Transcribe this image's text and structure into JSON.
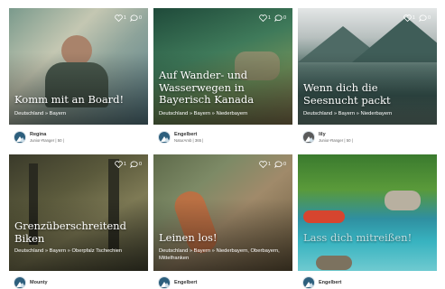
{
  "cards": [
    {
      "title": "Komm mit an Board!",
      "tags": "Deutschland » Bayern",
      "likes": "1",
      "comments": "0",
      "author": {
        "name": "Regina",
        "role": "Junior-Ranger | 50 |"
      }
    },
    {
      "title": "Auf Wander- und Wasserwegen in Bayerisch Kanada",
      "tags": "Deutschland » Bayern » Niederbayern",
      "likes": "1",
      "comments": "0",
      "author": {
        "name": "Engelbert",
        "role": "NaturAmb | 365 |"
      }
    },
    {
      "title": "Wenn dich die Seesnucht packt",
      "tags": "Deutschland » Bayern » Niederbayern",
      "likes": "1",
      "comments": "0",
      "author": {
        "name": "lily",
        "role": "Junior-Ranger | 50 |"
      }
    },
    {
      "title": "Grenzüberschreitend Biken",
      "tags": "Deutschland » Bayern » Oberpfalz Tschechien",
      "likes": "1",
      "comments": "0",
      "author": {
        "name": "Mounty",
        "role": ""
      }
    },
    {
      "title": "Leinen los!",
      "tags": "Deutschland » Bayern » Niederbayern, Oberbayern, Mittelfranken",
      "likes": "1",
      "comments": "0",
      "author": {
        "name": "Engelbert",
        "role": ""
      }
    },
    {
      "title": "Lass dich mitreißen!",
      "tags": "",
      "likes": "",
      "comments": "",
      "author": {
        "name": "Engelbert",
        "role": ""
      }
    }
  ],
  "icons": {
    "like": "heart-icon",
    "comment": "speech-bubble-icon"
  },
  "colors": {
    "avatar": "#2d5f7d",
    "text": "#333333"
  }
}
